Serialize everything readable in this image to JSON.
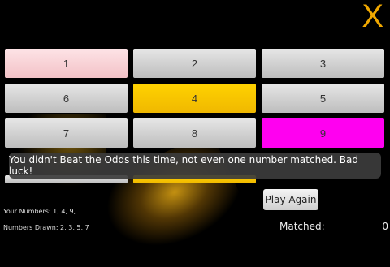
{
  "close_label": "X",
  "grid": {
    "cells": [
      "1",
      "2",
      "3",
      "6",
      "4",
      "5",
      "7",
      "8",
      "9"
    ]
  },
  "toast": "You didn't Beat the Odds this time, not even one number matched. Bad luck!",
  "your_numbers": "Your Numbers:  1, 4, 9, 11",
  "numbers_drawn": "Numbers Drawn:  2,  3,  5,  7",
  "play_again": "Play Again",
  "matched_label": "Matched:",
  "matched_value": "0",
  "colors": {
    "selected_no_match": "#fde3e6",
    "drawn": "#ffd200",
    "selected_and_drawn": "#ff00f0",
    "accent": "#f0a800"
  }
}
